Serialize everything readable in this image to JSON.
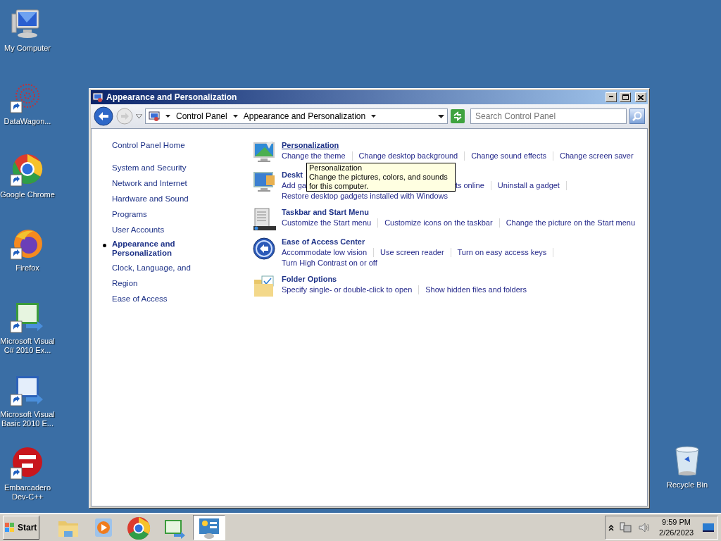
{
  "desktop_icons": [
    {
      "label": "My Computer",
      "kind": "computer",
      "shortcut": false
    },
    {
      "label": "DataWagon...",
      "kind": "datawagon",
      "shortcut": true
    },
    {
      "label": "Google Chrome",
      "kind": "chrome",
      "shortcut": true
    },
    {
      "label": "Firefox",
      "kind": "firefox",
      "shortcut": true
    },
    {
      "label": "Microsoft Visual C# 2010 Ex...",
      "kind": "vcs",
      "shortcut": true
    },
    {
      "label": "Microsoft Visual Basic 2010 E...",
      "kind": "vb",
      "shortcut": true
    },
    {
      "label": "Embarcadero Dev-C++",
      "kind": "dev",
      "shortcut": true
    }
  ],
  "recycle_bin": {
    "label": "Recycle Bin"
  },
  "window": {
    "title": "Appearance and Personalization",
    "breadcrumb": [
      "Control Panel",
      "Appearance and Personalization"
    ],
    "search": {
      "placeholder": "Search Control Panel"
    },
    "nav": [
      {
        "label": "Control Panel Home",
        "selected": false
      },
      {
        "label": "System and Security",
        "selected": false
      },
      {
        "label": "Network and Internet",
        "selected": false
      },
      {
        "label": "Hardware and Sound",
        "selected": false
      },
      {
        "label": "Programs",
        "selected": false
      },
      {
        "label": "User Accounts",
        "selected": false
      },
      {
        "label": "Appearance and Personalization",
        "selected": true
      },
      {
        "label": "Clock, Language, and Region",
        "selected": false
      },
      {
        "label": "Ease of Access",
        "selected": false
      }
    ],
    "sections": [
      {
        "kind": "personalization",
        "title": "Personalization",
        "hovered": true,
        "lines": [
          {
            "links": [
              {
                "text": "Change the theme"
              },
              {
                "text": "Change desktop background"
              },
              {
                "text": "Change sound effects"
              },
              {
                "text": "Change screen saver"
              }
            ],
            "trailing_divider": false
          }
        ]
      },
      {
        "kind": "gadgets",
        "title": "Deskt",
        "hovered": false,
        "lines": [
          {
            "links": [
              {
                "text": "Add ga"
              },
              {
                "text": "ts online",
                "hidden_gap": true
              },
              {
                "text": "Uninstall a gadget"
              }
            ],
            "trailing_divider": true
          },
          {
            "links": [
              {
                "text": "Restore desktop gadgets installed with Windows"
              }
            ],
            "trailing_divider": false
          }
        ]
      },
      {
        "kind": "taskbar",
        "title": "Taskbar and Start Menu",
        "hovered": false,
        "lines": [
          {
            "links": [
              {
                "text": "Customize the Start menu"
              },
              {
                "text": "Customize icons on the taskbar"
              },
              {
                "text": "Change the picture on the Start menu"
              }
            ],
            "trailing_divider": false
          }
        ]
      },
      {
        "kind": "access",
        "title": "Ease of Access Center",
        "hovered": false,
        "lines": [
          {
            "links": [
              {
                "text": "Accommodate low vision"
              },
              {
                "text": "Use screen reader"
              },
              {
                "text": "Turn on easy access keys"
              }
            ],
            "trailing_divider": true
          },
          {
            "links": [
              {
                "text": "Turn High Contrast on or off"
              }
            ],
            "trailing_divider": false
          }
        ]
      },
      {
        "kind": "folder",
        "title": "Folder Options",
        "hovered": false,
        "lines": [
          {
            "links": [
              {
                "text": "Specify single- or double-click to open"
              },
              {
                "text": "Show hidden files and folders"
              }
            ],
            "trailing_divider": false
          }
        ]
      }
    ],
    "tooltip": {
      "title": "Personalization",
      "text": "Change the pictures, colors, and sounds for this computer."
    }
  },
  "taskbar": {
    "start": "Start",
    "apps": [
      {
        "kind": "explorer",
        "active": false
      },
      {
        "kind": "media",
        "active": false
      },
      {
        "kind": "chrome",
        "active": false
      },
      {
        "kind": "vcs",
        "active": false
      },
      {
        "kind": "controlpanel",
        "active": true
      }
    ],
    "time": "9:59 PM",
    "date": "2/26/2023"
  }
}
